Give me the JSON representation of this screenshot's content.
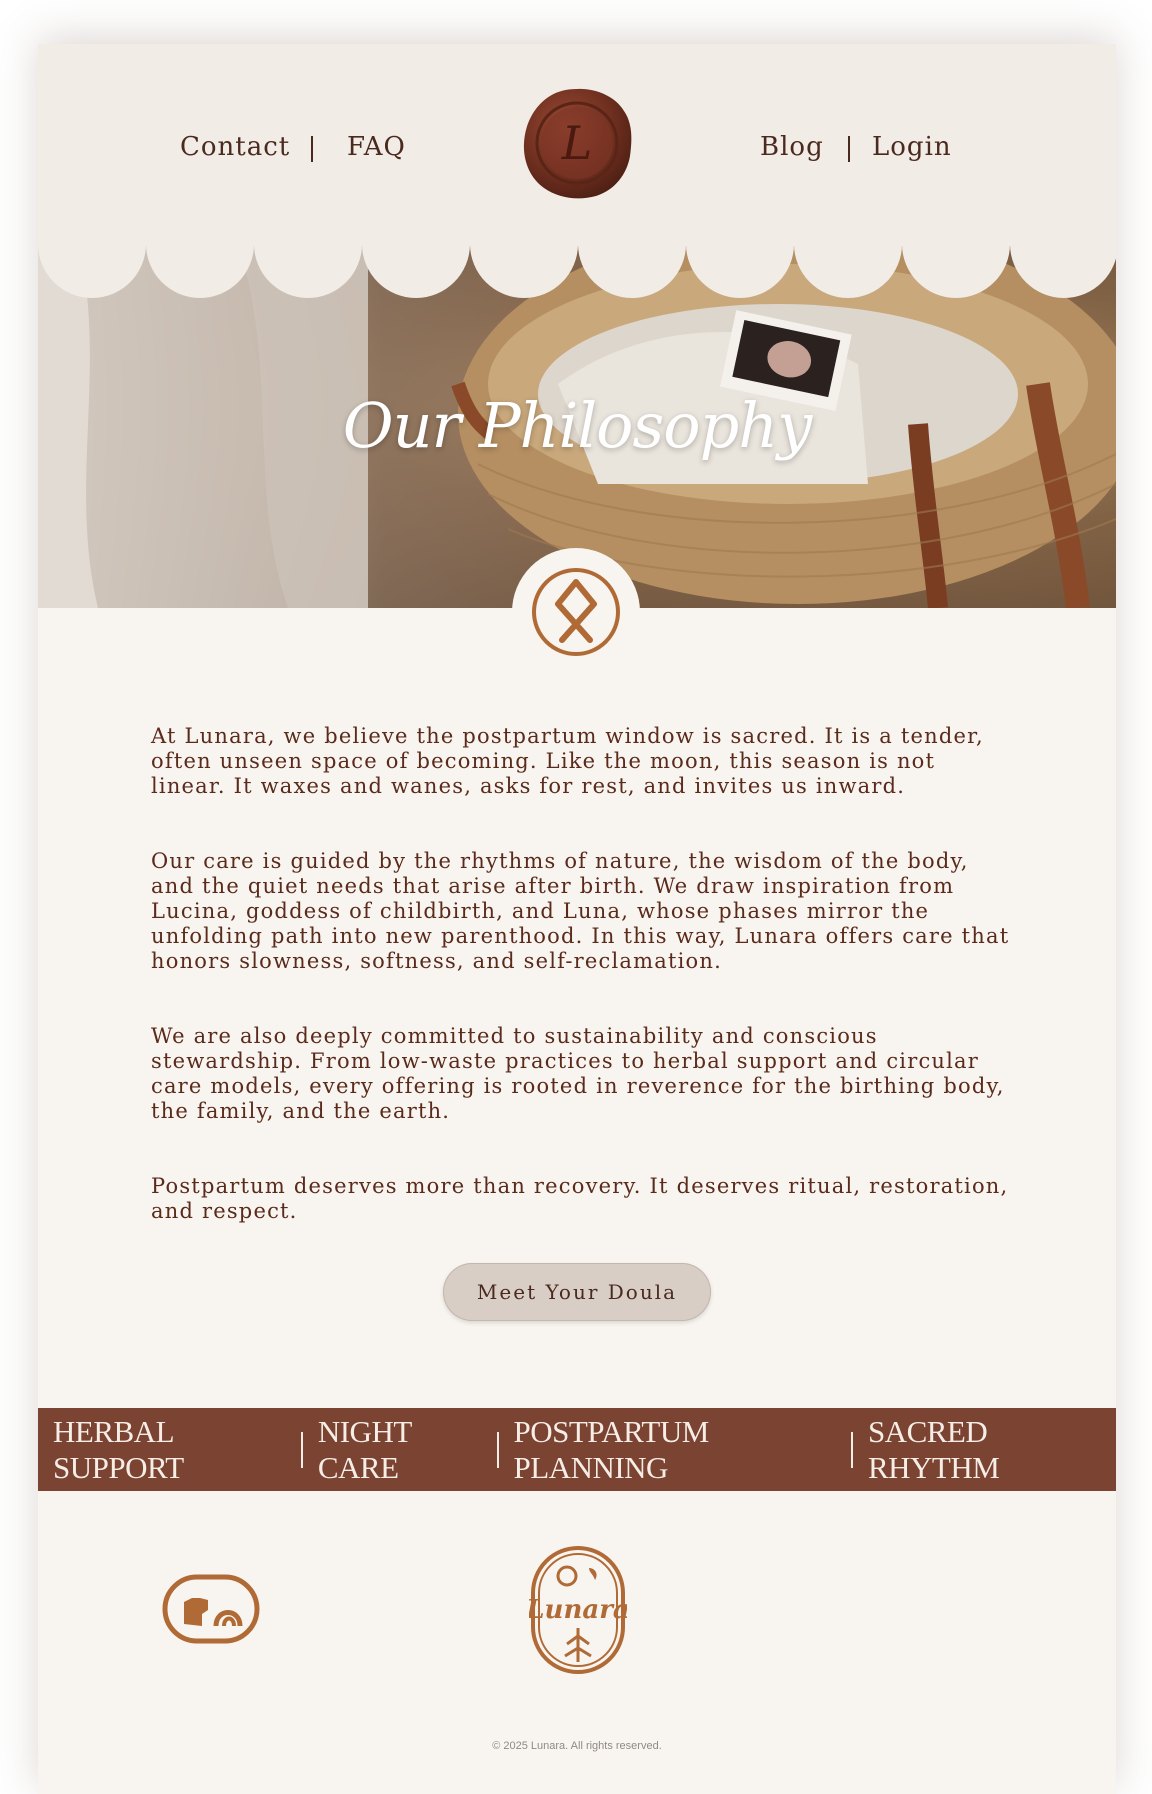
{
  "nav": {
    "contact": "Contact",
    "faq": "FAQ",
    "blog": "Blog",
    "login": "Login",
    "seal_letter": "L"
  },
  "hero": {
    "title": "Our Philosophy"
  },
  "content": {
    "paragraphs": [
      "At Lunara, we believe the postpartum window is sacred. It is a tender, often unseen space of becoming. Like the moon, this season is not linear. It waxes and wanes, asks for rest, and invites us inward.",
      "Our care is guided by the rhythms of nature, the wisdom of the body, and the quiet needs that arise after birth. We draw inspiration from Lucina, goddess of childbirth, and Luna, whose phases mirror the unfolding path into new parenthood. In this way, Lunara offers care that honors slowness, softness, and self-reclamation.",
      "We are also deeply committed to sustainability and conscious stewardship. From low-waste practices to herbal support and circular care models, every offering is rooted in reverence for the birthing body, the family, and the earth.",
      "Postpartum deserves more than recovery. It deserves ritual, restoration, and respect."
    ],
    "cta_label": "Meet Your Doula"
  },
  "services": [
    "Herbal Support",
    "Night Care",
    "Postpartum Planning",
    "Sacred Rhythm"
  ],
  "footer": {
    "logo_text": "Lunara",
    "copyright": "© 2025 Lunara. All rights reserved."
  },
  "colors": {
    "brand": "#7b4332",
    "text": "#5a2a1a",
    "accent": "#b06a35",
    "background": "#f8f4f0",
    "header": "#f1ece6"
  },
  "icons": [
    "wax-seal-icon",
    "othala-rune-icon",
    "fist-rainbow-icon",
    "lunara-badge-icon"
  ]
}
